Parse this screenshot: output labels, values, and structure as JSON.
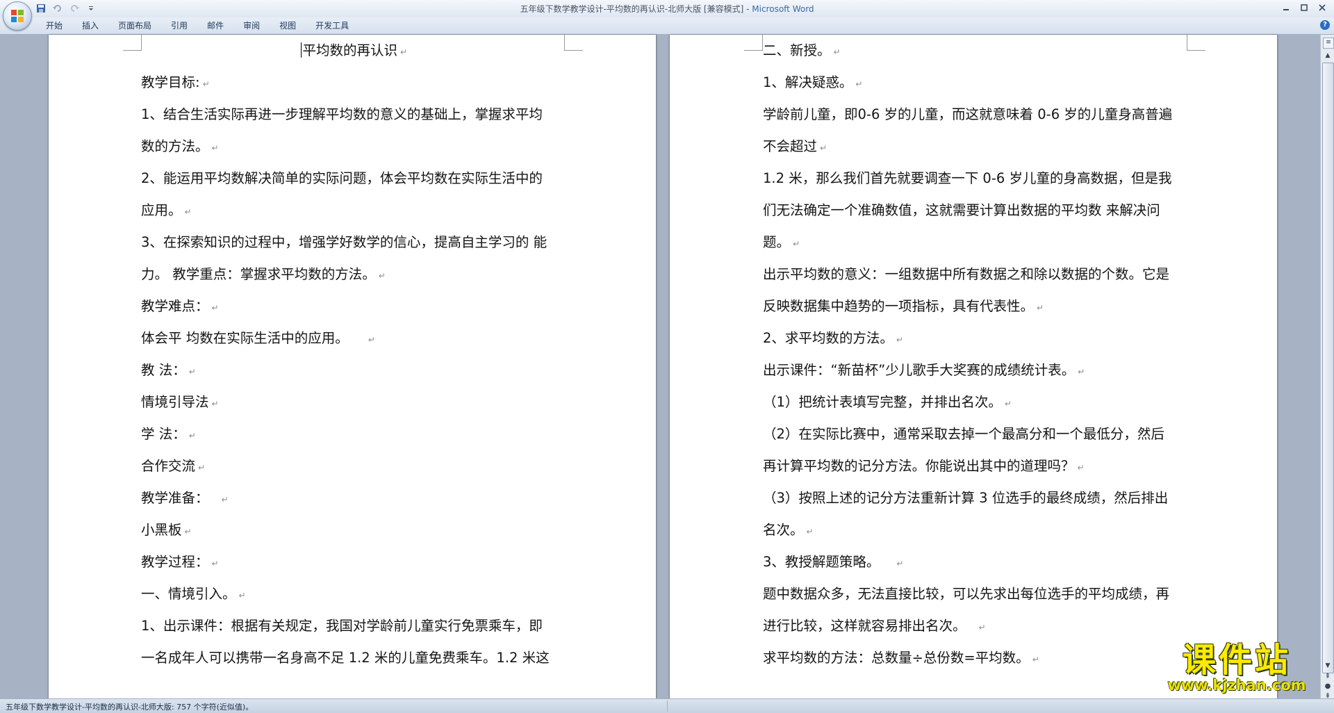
{
  "window": {
    "title_doc": "五年级下数学教学设计-平均数的再认识-北师大版 [兼容模式] - ",
    "title_app": "Microsoft Word"
  },
  "ribbon": {
    "tabs": [
      "开始",
      "插入",
      "页面布局",
      "引用",
      "邮件",
      "审阅",
      "视图",
      "开发工具"
    ]
  },
  "document": {
    "left_page": {
      "title": "平均数的再认识",
      "lines": [
        "教学目标:",
        "1、结合生活实际再进一步理解平均数的意义的基础上，掌握求平均",
        "数的方法。",
        "2、能运用平均数解决简单的实际问题，体会平均数在实际生活中的",
        "应用。",
        "3、在探索知识的过程中，增强学好数学的信心，提高自主学习的 能",
        "力。  教学重点：掌握求平均数的方法。",
        "教学难点：",
        "体会平 均数在实际生活中的应用。",
        "教  法：",
        "情境引导法",
        "学  法：",
        "合作交流",
        "教学准备：",
        "小黑板",
        "教学过程：",
        "一、情境引入。",
        "1、出示课件：根据有关规定，我国对学龄前儿童实行免票乘车，即",
        "一名成年人可以携带一名身高不足 1.2 米的儿童免费乘车。1.2 米这"
      ]
    },
    "right_page": {
      "lines": [
        "二、新授。",
        "1、解决疑惑。",
        "学龄前儿童，即0-6 岁的儿童，而这就意味着 0-6 岁的儿童身高普遍",
        "不会超过",
        "1.2 米，那么我们首先就要调查一下 0-6 岁儿童的身高数据，但是我",
        "们无法确定一个准确数值，这就需要计算出数据的平均数 来解决问",
        "题。",
        "出示平均数的意义：一组数据中所有数据之和除以数据的个数。它是",
        "反映数据集中趋势的一项指标，具有代表性。",
        "2、求平均数的方法。",
        "出示课件：“新苗杯”少儿歌手大奖赛的成绩统计表。",
        "（1）把统计表填写完整，并排出名次。",
        "（2）在实际比赛中，通常采取去掉一个最高分和一个最低分，然后",
        "再计算平均数的记分方法。你能说出其中的道理吗？",
        "（3）按照上述的记分方法重新计算 3 位选手的最终成绩，然后排出",
        "名次。",
        "3、教授解题策略。",
        "题中数据众多，无法直接比较，可以先求出每位选手的平均成绩，再",
        "进行比较，这样就容易排出名次。",
        "求平均数的方法：总数量÷总份数=平均数。"
      ]
    }
  },
  "statusbar": {
    "text": "五年级下数学教学设计-平均数的再认识-北师大版: 757 个字符(近似值)。"
  },
  "watermark": {
    "text_cn": "课件站",
    "url": "www.kjzhan.com"
  },
  "colors": {
    "workspace": "#a7b3c4",
    "accent": "#3a6aa8",
    "watermark_yellow": "#ffea00"
  },
  "icons": {
    "office_button": "office-logo-icon",
    "qat": [
      "save-icon",
      "undo-icon",
      "redo-icon",
      "customize-qat-icon"
    ],
    "window": [
      "minimize-icon",
      "maximize-icon",
      "close-icon"
    ],
    "help": "help-icon"
  }
}
